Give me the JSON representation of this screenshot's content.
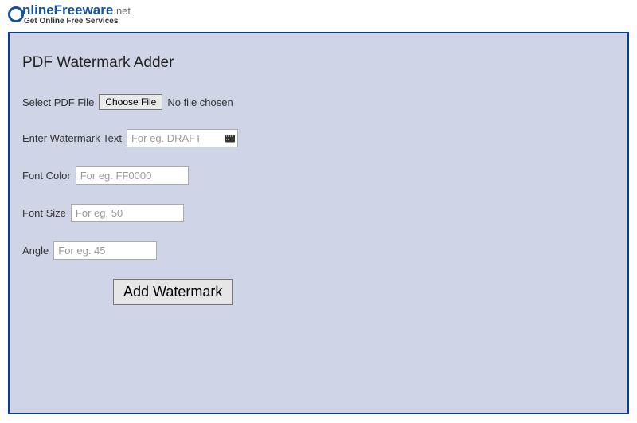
{
  "header": {
    "brand_part1": "nlineFreeware",
    "brand_part2": ".net",
    "tagline": "Get Online Free Services"
  },
  "page": {
    "title": "PDF Watermark Adder"
  },
  "form": {
    "file": {
      "label": "Select PDF File",
      "button": "Choose File",
      "status": "No file chosen"
    },
    "watermark_text": {
      "label": "Enter Watermark Text",
      "placeholder": "For eg. DRAFT"
    },
    "font_color": {
      "label": "Font Color",
      "placeholder": "For eg. FF0000"
    },
    "font_size": {
      "label": "Font Size",
      "placeholder": "For eg. 50"
    },
    "angle": {
      "label": "Angle",
      "placeholder": "For eg. 45"
    },
    "submit_label": "Add Watermark"
  }
}
